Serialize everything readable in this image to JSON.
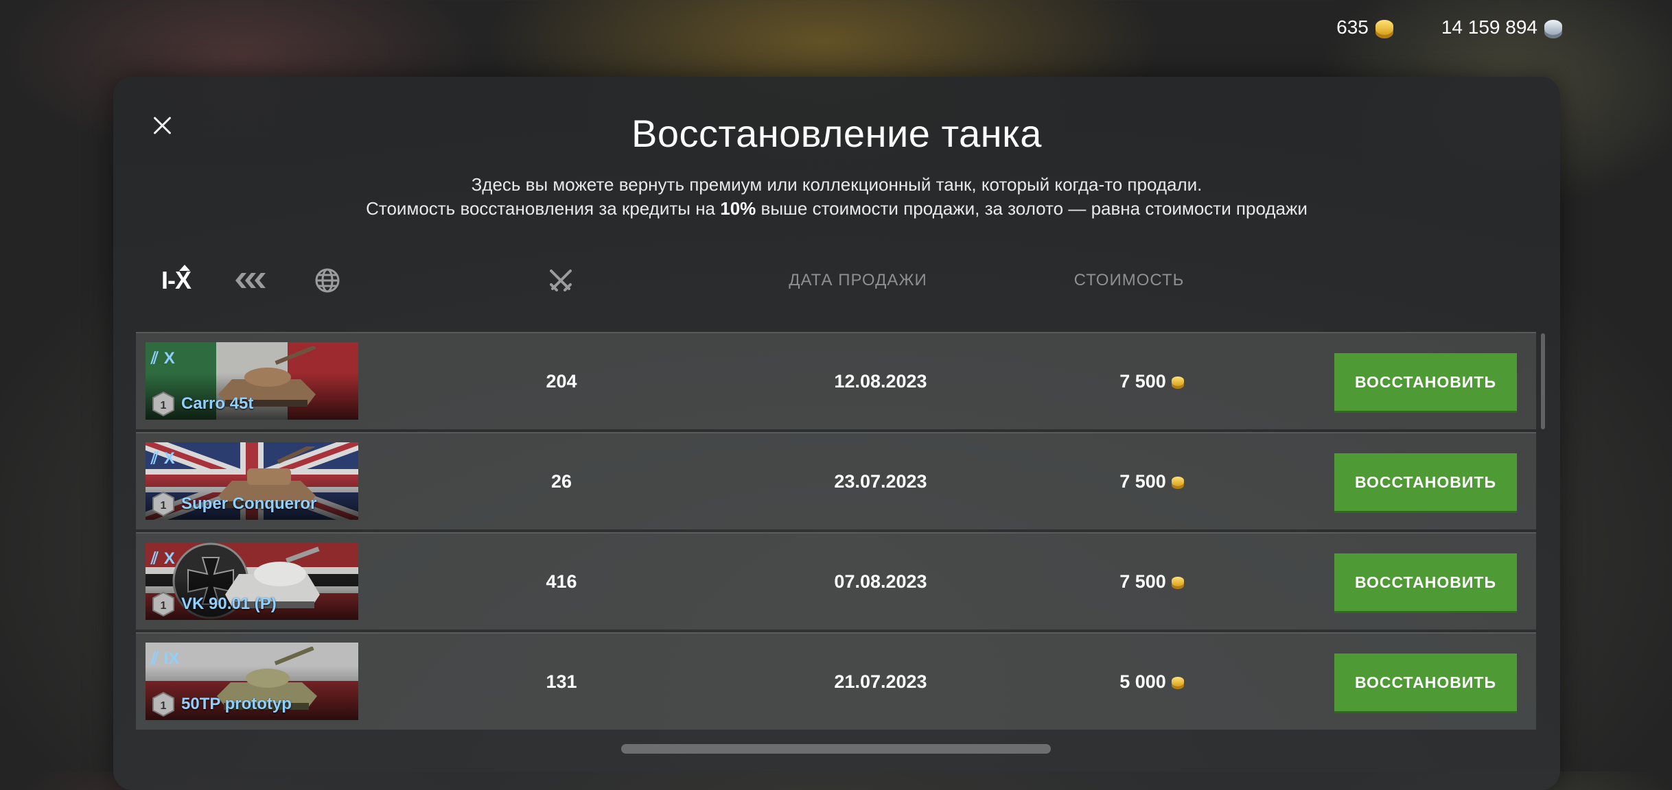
{
  "currency": {
    "gold": "635",
    "silver": "14 159 894"
  },
  "dialog": {
    "title": "Восстановление танка",
    "desc_line1": "Здесь вы можете вернуть премиум или коллекционный танк, который когда-то продали.",
    "desc_line2_a": "Стоимость восстановления за кредиты на ",
    "desc_line2_b": "10%",
    "desc_line2_c": " выше стоимости продажи, за золото — равна стоимости продажи"
  },
  "filters": {
    "tier": "I-X",
    "type_icon": "tank-type-icon",
    "nation_icon": "globe-icon"
  },
  "columns": {
    "battles_icon": "crossed-swords-icon",
    "date": "ДАТА ПРОДАЖИ",
    "cost": "СТОИМОСТЬ"
  },
  "rows": [
    {
      "tier": "X",
      "name": "Carro 45t",
      "mastery": "1",
      "battles": "204",
      "date": "12.08.2023",
      "cost": "7 500",
      "button": "ВОССТАНОВИТЬ",
      "nation_flag": "italy"
    },
    {
      "tier": "X",
      "name": "Super Conqueror",
      "mastery": "1",
      "battles": "26",
      "date": "23.07.2023",
      "cost": "7 500",
      "button": "ВОССТАНОВИТЬ",
      "nation_flag": "uk"
    },
    {
      "tier": "X",
      "name": "VK 90.01 (P)",
      "mastery": "1",
      "battles": "416",
      "date": "07.08.2023",
      "cost": "7 500",
      "button": "ВОССТАНОВИТЬ",
      "nation_flag": "germany"
    },
    {
      "tier": "IX",
      "name": "50TP prototyp",
      "mastery": "1",
      "battles": "131",
      "date": "21.07.2023",
      "cost": "5 000",
      "button": "ВОССТАНОВИТЬ",
      "nation_flag": "poland"
    }
  ],
  "colors": {
    "button": "#4e9a34",
    "name_blue": "#8fd0ff",
    "gold": "#f2c23a"
  }
}
